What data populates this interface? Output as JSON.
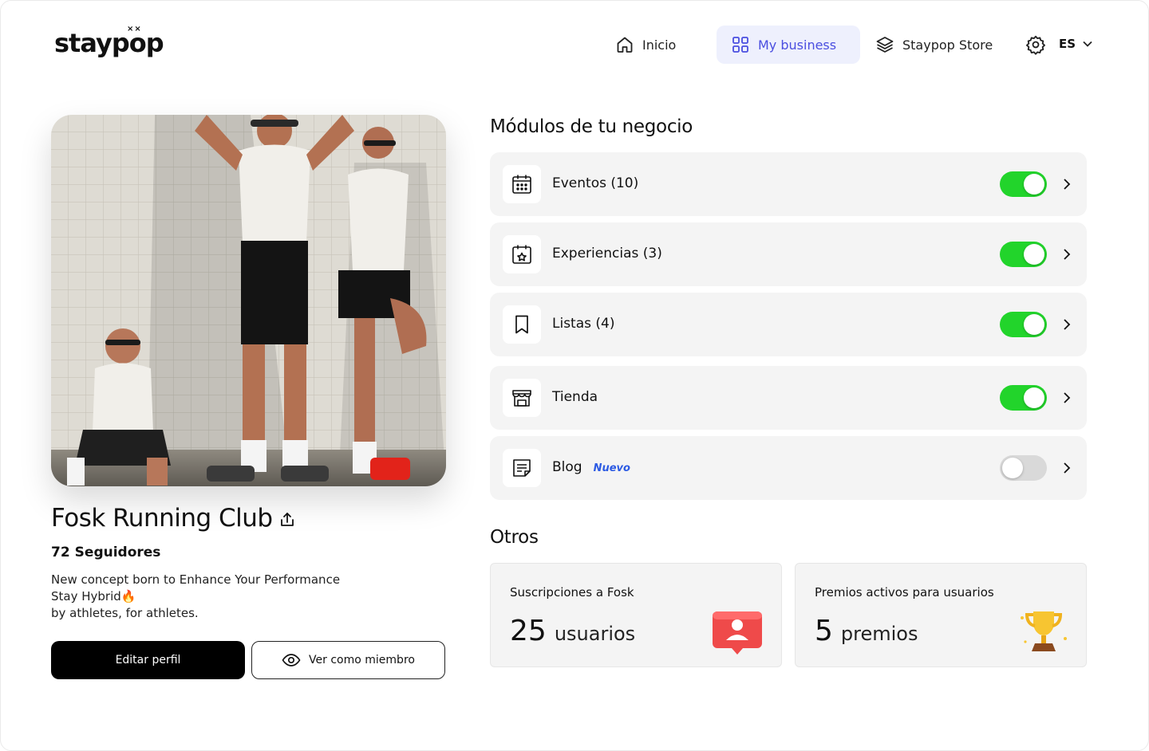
{
  "brand": {
    "logo": "staypop",
    "logo_dots": "××"
  },
  "nav": {
    "inicio": "Inicio",
    "my_business": "My business",
    "store": "Staypop Store",
    "language": "ES"
  },
  "profile": {
    "name": "Fosk Running Club",
    "followers_count": "72",
    "followers_label": "Seguidores",
    "bio_lines": [
      "New concept born to Enhance Your Performance",
      "Stay Hybrid🔥",
      "by athletes, for athletes."
    ],
    "edit_button": "Editar perfil",
    "view_button": "Ver como miembro"
  },
  "modules": {
    "title": "Módulos de tu negocio",
    "items": [
      {
        "label": "Eventos (10)",
        "icon": "calendar-icon",
        "enabled": true
      },
      {
        "label": "Experiencias (3)",
        "icon": "calendar-star-icon",
        "enabled": true
      },
      {
        "label": "Listas (4)",
        "icon": "bookmark-icon",
        "enabled": true
      },
      {
        "label": "Tienda",
        "icon": "storefront-icon",
        "enabled": true
      },
      {
        "label": "Blog",
        "badge": "Nuevo",
        "icon": "note-icon",
        "enabled": false
      }
    ]
  },
  "others": {
    "title": "Otros",
    "subscriptions": {
      "title": "Suscripciones a Fosk",
      "value": "25",
      "unit": "usuarios"
    },
    "rewards": {
      "title": "Premios activos para usuarios",
      "value": "5",
      "unit": "premios"
    }
  },
  "colors": {
    "accent": "#4a4ee0",
    "toggle_on": "#22d42b",
    "toggle_off": "#d9d9d9",
    "badge": "#2d5be3"
  }
}
